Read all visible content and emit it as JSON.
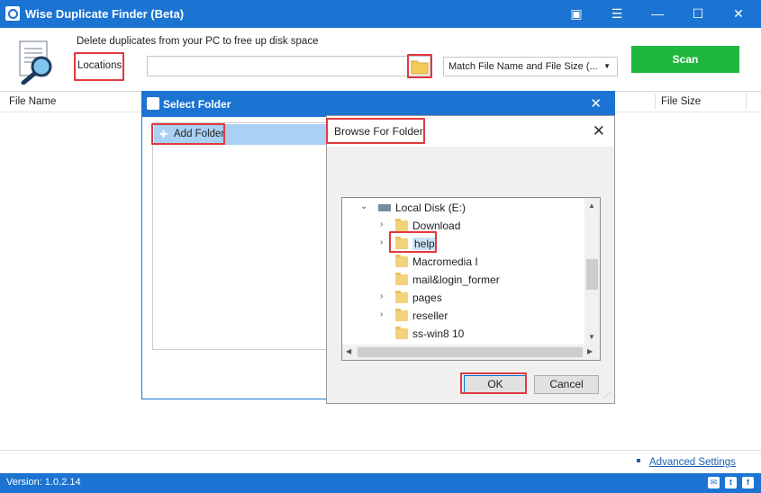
{
  "app": {
    "title": "Wise Duplicate Finder (Beta)",
    "title_buttons": [
      "▣",
      "☰",
      "—",
      "☐",
      "✕"
    ]
  },
  "header": {
    "tagline": "Delete duplicates from your PC to free up disk space",
    "locations_label": "Locations:",
    "locations_value": "",
    "match_mode": "Match File Name and File Size (...",
    "scan_label": "Scan"
  },
  "columns": {
    "file_name": "File Name",
    "file_size": "File Size"
  },
  "footer": {
    "advanced_settings": "Advanced Settings",
    "version": "Version: 1.0.2.14",
    "social": [
      "✉",
      "t",
      "f"
    ]
  },
  "select_folder": {
    "title": "Select Folder",
    "add_folder": "Add Folder"
  },
  "browse_folder": {
    "title": "Browse For Folder",
    "tree": [
      {
        "label": "Local Disk (E:)",
        "type": "drive",
        "expanded": true
      },
      {
        "label": "Download",
        "type": "folder",
        "expandable": true
      },
      {
        "label": "help",
        "type": "folder",
        "expandable": true,
        "selected": true
      },
      {
        "label": "Macromedia I",
        "type": "folder",
        "expandable": false
      },
      {
        "label": "mail&login_former",
        "type": "folder",
        "expandable": false
      },
      {
        "label": "pages",
        "type": "folder",
        "expandable": true
      },
      {
        "label": "reseller",
        "type": "folder",
        "expandable": true
      },
      {
        "label": "ss-win8 10",
        "type": "folder",
        "expandable": false
      }
    ],
    "ok_label": "OK",
    "cancel_label": "Cancel"
  },
  "colors": {
    "accent": "#1b74d2",
    "scan_green": "#1eb83e",
    "highlight_red": "#e0393e",
    "selection": "#a9d1f5"
  }
}
